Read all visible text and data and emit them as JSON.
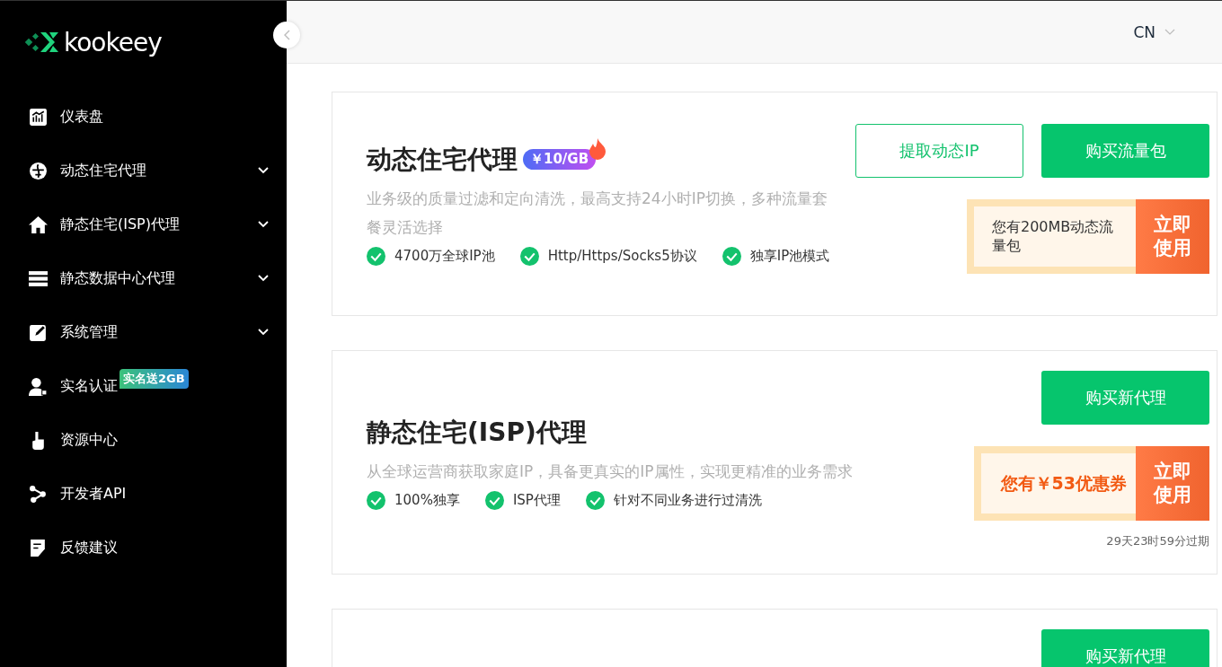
{
  "logo": {
    "text": "kookeey"
  },
  "sidebar": {
    "items": [
      {
        "label": "仪表盘",
        "expandable": false
      },
      {
        "label": "动态住宅代理",
        "expandable": true
      },
      {
        "label": "静态住宅(ISP)代理",
        "expandable": true
      },
      {
        "label": "静态数据中心代理",
        "expandable": true
      },
      {
        "label": "系统管理",
        "expandable": true
      },
      {
        "label": "实名认证",
        "expandable": false,
        "badge": "实名送2GB"
      },
      {
        "label": "资源中心",
        "expandable": false
      },
      {
        "label": "开发者API",
        "expandable": false
      },
      {
        "label": "反馈建议",
        "expandable": false
      }
    ]
  },
  "header": {
    "language": "CN"
  },
  "cards": [
    {
      "title": "动态住宅代理",
      "price_badge": "￥10/GB",
      "description": "业务级的质量过滤和定向清洗，最高支持24小时IP切换，多种流量套餐灵活选择",
      "features": [
        "4700万全球IP池",
        "Http/Https/Socks5协议",
        "独享IP池模式"
      ],
      "buttons": [
        {
          "label": "提取动态IP",
          "kind": "outline"
        },
        {
          "label": "购买流量包",
          "kind": "primary"
        }
      ],
      "coupon": {
        "text": "您有200MB动态流量包",
        "action": "立即使用",
        "kind": "plain"
      }
    },
    {
      "title": "静态住宅(ISP)代理",
      "description": "从全球运营商获取家庭IP，具备更真实的IP属性，实现更精准的业务需求",
      "features": [
        "100%独享",
        "ISP代理",
        "针对不同业务进行过清洗"
      ],
      "buttons": [
        {
          "label": "购买新代理",
          "kind": "primary"
        }
      ],
      "coupon": {
        "text": "您有￥53优惠券",
        "action": "立即使用",
        "kind": "accent",
        "expiry": "29天23时59分过期"
      }
    },
    {
      "buttons": [
        {
          "label": "购买新代理",
          "kind": "primary"
        }
      ]
    }
  ]
}
